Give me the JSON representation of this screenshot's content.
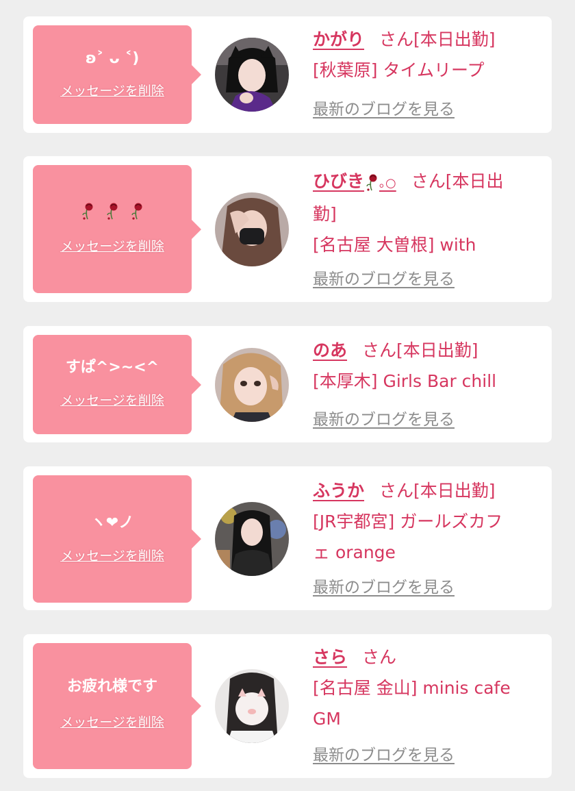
{
  "delete_label": "メッセージを削除",
  "blog_label": "最新のブログを見る",
  "colors": {
    "background": "#eeeeee",
    "card": "#ffffff",
    "bubble": "#f9919f",
    "name_text": "#d6365f",
    "link_gray": "#8c8c8c"
  },
  "cards": [
    {
      "message": "ʚ⁠˃ ᴗ ˂⁠)",
      "name": "かがり",
      "suffix": "さん[本日出勤]",
      "location_line": "[秋葉原] タイムリープ",
      "avatar": "avatar-photo"
    },
    {
      "message_icons": [
        "wilted-rose-icon",
        "wilted-rose-icon",
        "wilted-rose-icon"
      ],
      "name": "ひびき",
      "name_icons": [
        "wilted-rose-icon",
        "small-circles-icon"
      ],
      "name_trail": "｡○",
      "suffix": "さん[本日出",
      "suffix_2": "勤]",
      "location_line": "[名古屋 大曽根] with",
      "avatar": "avatar-photo"
    },
    {
      "message": "すぱ^>~<^",
      "name": "のあ",
      "suffix": "さん[本日出勤]",
      "location_line": "[本厚木] Girls Bar chill",
      "avatar": "avatar-photo"
    },
    {
      "message": "ヽ❤︎ノ",
      "name": "ふうか",
      "suffix": "さん[本日出勤]",
      "location_line": "[JR宇都宮] ガールズカフ",
      "location_line_2": "ェ orange",
      "avatar": "avatar-photo"
    },
    {
      "message": "お疲れ様です",
      "name": "さら",
      "suffix": "さん",
      "location_line": "[名古屋 金山] minis cafe",
      "location_line_2": "GM",
      "avatar": "avatar-photo"
    }
  ]
}
